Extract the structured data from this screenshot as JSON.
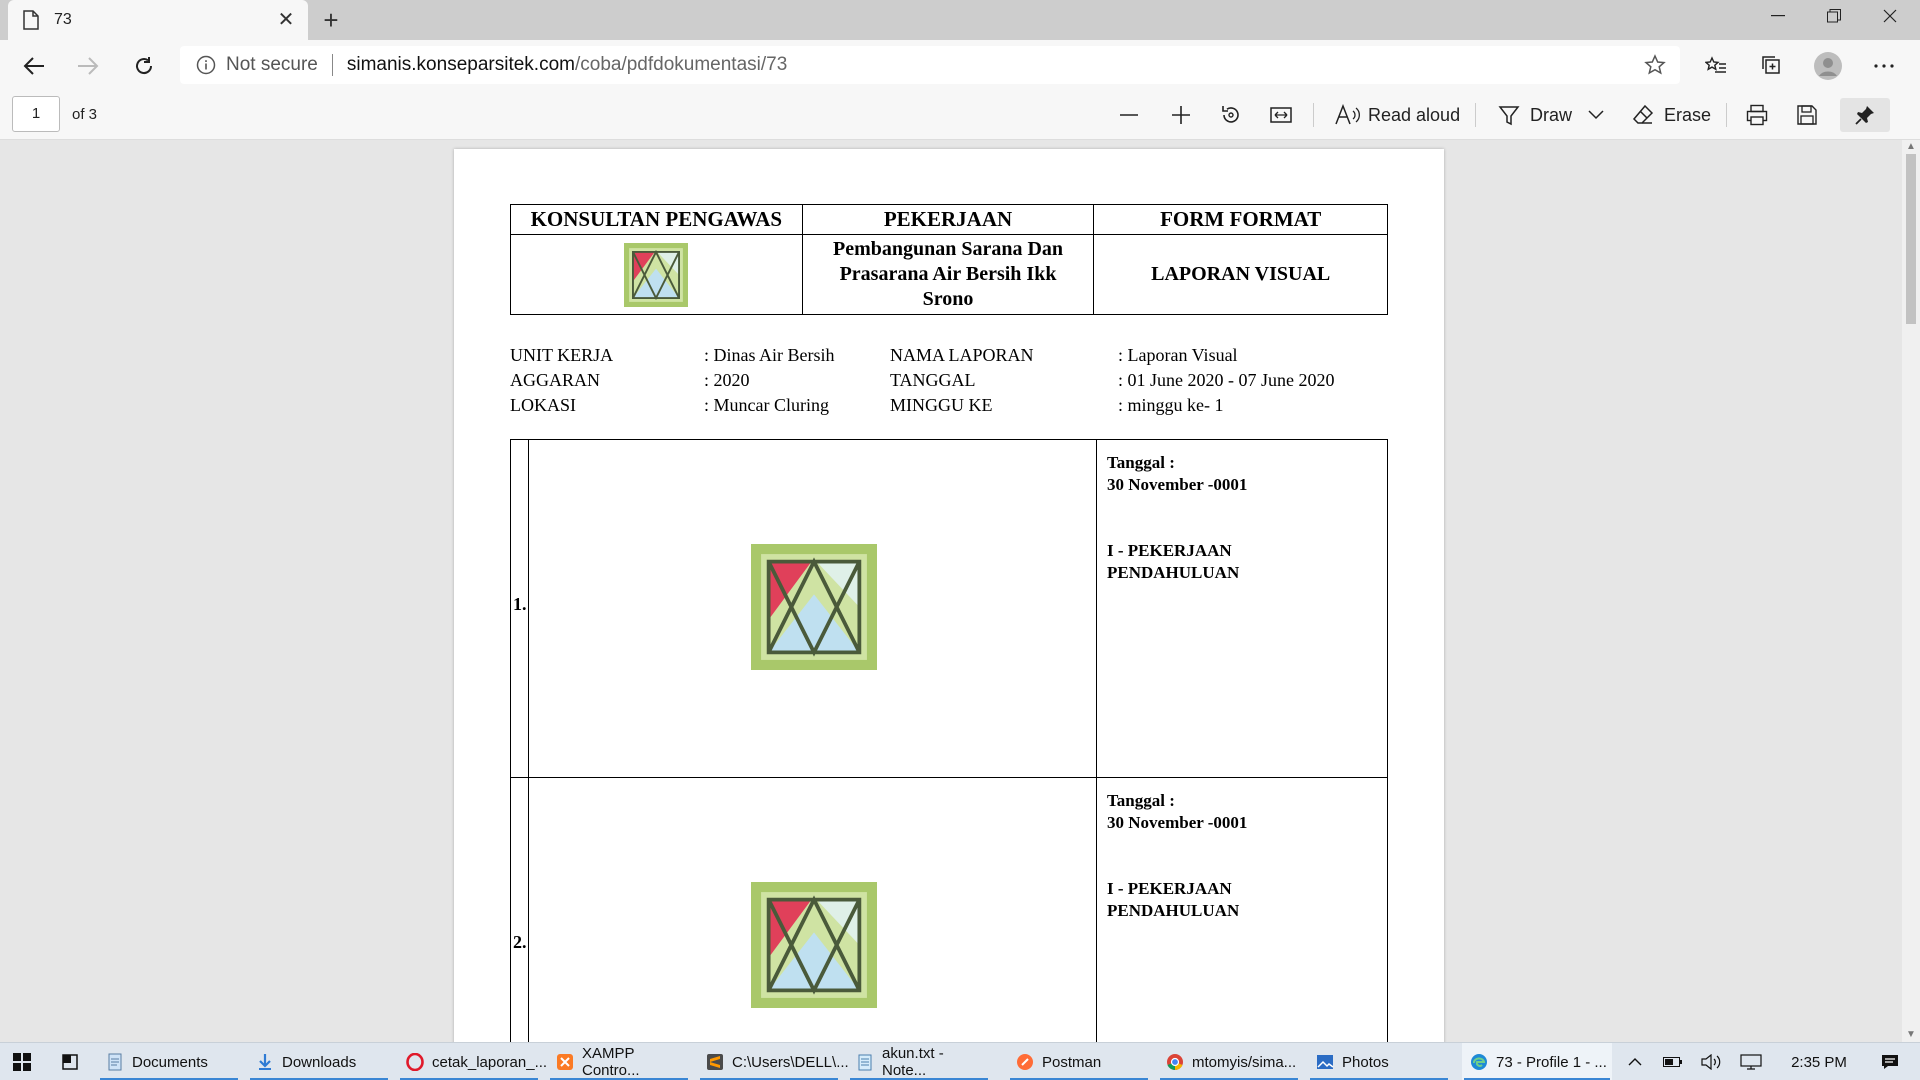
{
  "browser": {
    "tab_title": "73",
    "url_security": "Not secure",
    "url_host": "simanis.konseparsitek.com",
    "url_path": "/coba/pdfdokumentasi/73"
  },
  "pdf_toolbar": {
    "page_current": "1",
    "page_total": "of 3",
    "read_aloud": "Read aloud",
    "draw": "Draw",
    "erase": "Erase"
  },
  "document": {
    "header": {
      "col1_title": "KONSULTAN PENGAWAS",
      "col2_title": "PEKERJAAN",
      "col3_title": "FORM FORMAT",
      "project_line1": "Pembangunan Sarana Dan",
      "project_line2": "Prasarana Air Bersih Ikk",
      "project_line3": "Srono",
      "form_name": "LAPORAN VISUAL"
    },
    "info": {
      "labels_left": [
        "UNIT KERJA",
        "AGGARAN",
        "LOKASI"
      ],
      "values_left": [
        ": Dinas Air Bersih",
        ": 2020",
        ": Muncar Cluring"
      ],
      "labels_right": [
        "NAMA LAPORAN",
        "TANGGAL",
        "MINGGU KE"
      ],
      "values_right": [
        ": Laporan Visual",
        ": 01 June 2020 - 07 June 2020",
        ": minggu ke- 1"
      ]
    },
    "entries": [
      {
        "number": "1.",
        "date_label": "Tanggal :",
        "date_value": "30 November -0001",
        "work_line1": "I - PEKERJAAN",
        "work_line2": "PENDAHULUAN"
      },
      {
        "number": "2.",
        "date_label": "Tanggal :",
        "date_value": "30 November -0001",
        "work_line1": "I - PEKERJAAN",
        "work_line2": "PENDAHULUAN"
      }
    ]
  },
  "taskbar": {
    "items": [
      "Documents",
      "Downloads",
      "cetak_laporan_...",
      "XAMPP Contro...",
      "C:\\Users\\DELL\\...",
      "akun.txt - Note...",
      "Postman",
      "mtomyis/sima...",
      "Photos",
      "73 - Profile 1 - ..."
    ],
    "clock": "2:35 PM"
  }
}
